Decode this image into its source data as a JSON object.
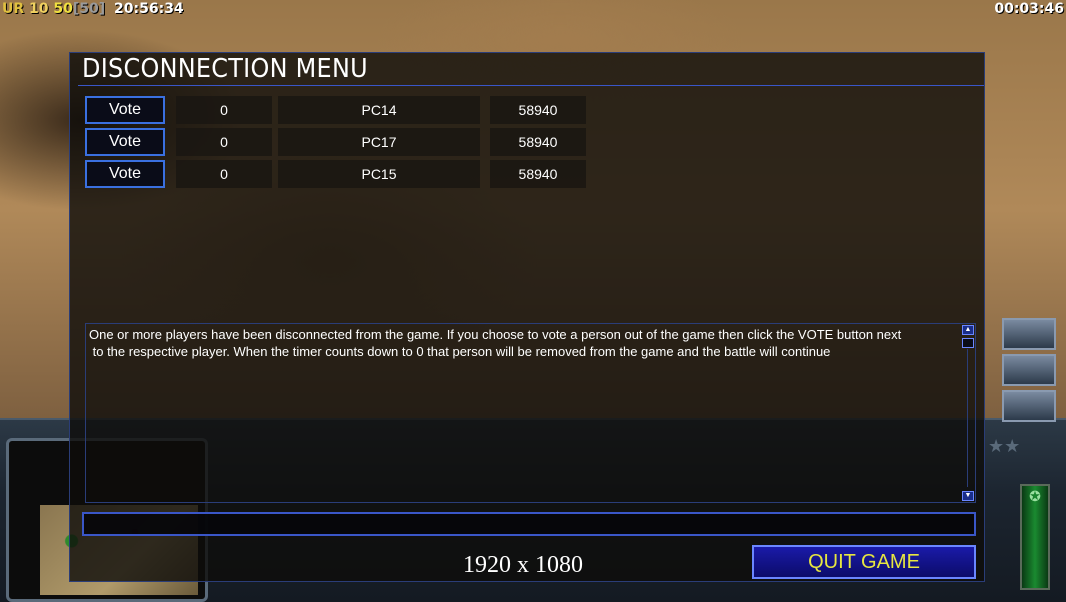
{
  "hud": {
    "ur_label": "UR",
    "stat_a": "10",
    "stat_b": "50",
    "stat_c": "[50]",
    "clock": "20:56:34",
    "game_timer": "00:03:46"
  },
  "dialog": {
    "title": "DISCONNECTION MENU",
    "players": [
      {
        "vote_label": "Vote",
        "count": "0",
        "name": "PC14",
        "score": "58940"
      },
      {
        "vote_label": "Vote",
        "count": "0",
        "name": "PC17",
        "score": "58940"
      },
      {
        "vote_label": "Vote",
        "count": "0",
        "name": "PC15",
        "score": "58940"
      }
    ],
    "message_line1": "One or more players have been disconnected from the game. If you choose to vote a person out of the game then click the VOTE button next",
    "message_line2": " to the respective player. When the timer counts down to 0 that person will be removed from the game and the battle will continue",
    "chat_value": "",
    "quit_label": "QUIT GAME"
  },
  "overlay": {
    "resolution": "1920 x 1080"
  },
  "colors": {
    "accent_blue": "#3a70e0",
    "quit_text": "#e6e640"
  }
}
